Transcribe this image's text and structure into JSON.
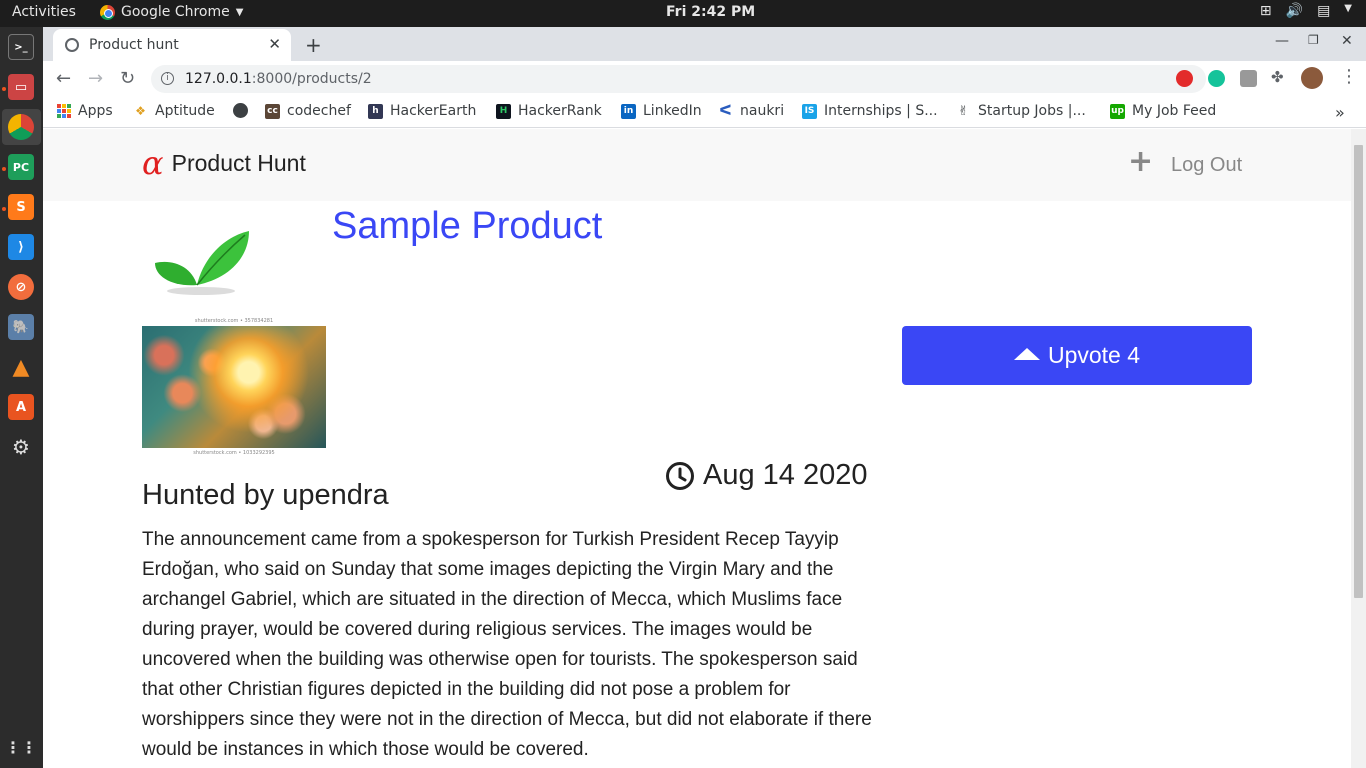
{
  "topbar": {
    "activities": "Activities",
    "app_name": "Google Chrome",
    "clock": "Fri  2:42 PM"
  },
  "browser": {
    "tab_title": "Product hunt",
    "url_host": "127.0.0.1",
    "url_path": ":8000/products/2",
    "bookmarks": [
      {
        "label": "Apps"
      },
      {
        "label": "Aptitude"
      },
      {
        "label": ""
      },
      {
        "label": "codechef"
      },
      {
        "label": "HackerEarth"
      },
      {
        "label": "HackerRank"
      },
      {
        "label": "LinkedIn"
      },
      {
        "label": "naukri"
      },
      {
        "label": "Internships | S..."
      },
      {
        "label": "Startup Jobs |..."
      },
      {
        "label": "My Job Feed"
      }
    ]
  },
  "site": {
    "brand_symbol": "α",
    "brand_name": "Product Hunt",
    "nav_plus": "+",
    "nav_logout": "Log Out"
  },
  "product": {
    "title": "Sample Product",
    "watermark_top": "shutterstock.com • 357834281",
    "watermark_bottom": "shutterstock.com • 1033292395",
    "upvote_label": "Upvote 4",
    "date": "Aug 14 2020",
    "hunter": "Hunted by upendra",
    "body": "The announcement came from a spokesperson for Turkish President Recep Tayyip Erdoğan, who said on Sunday that some images depicting the Virgin Mary and the archangel Gabriel, which are situated in the direction of Mecca, which Muslims face during prayer, would be covered during religious services. The images would be uncovered when the building was otherwise open for tourists. The spokesperson said that other Christian figures depicted in the building did not pose a problem for worshippers since they were not in the direction of Mecca, but did not elaborate if there would be instances in which those would be covered."
  },
  "colors": {
    "accent": "#3a47f5",
    "brand_red": "#e02020"
  }
}
